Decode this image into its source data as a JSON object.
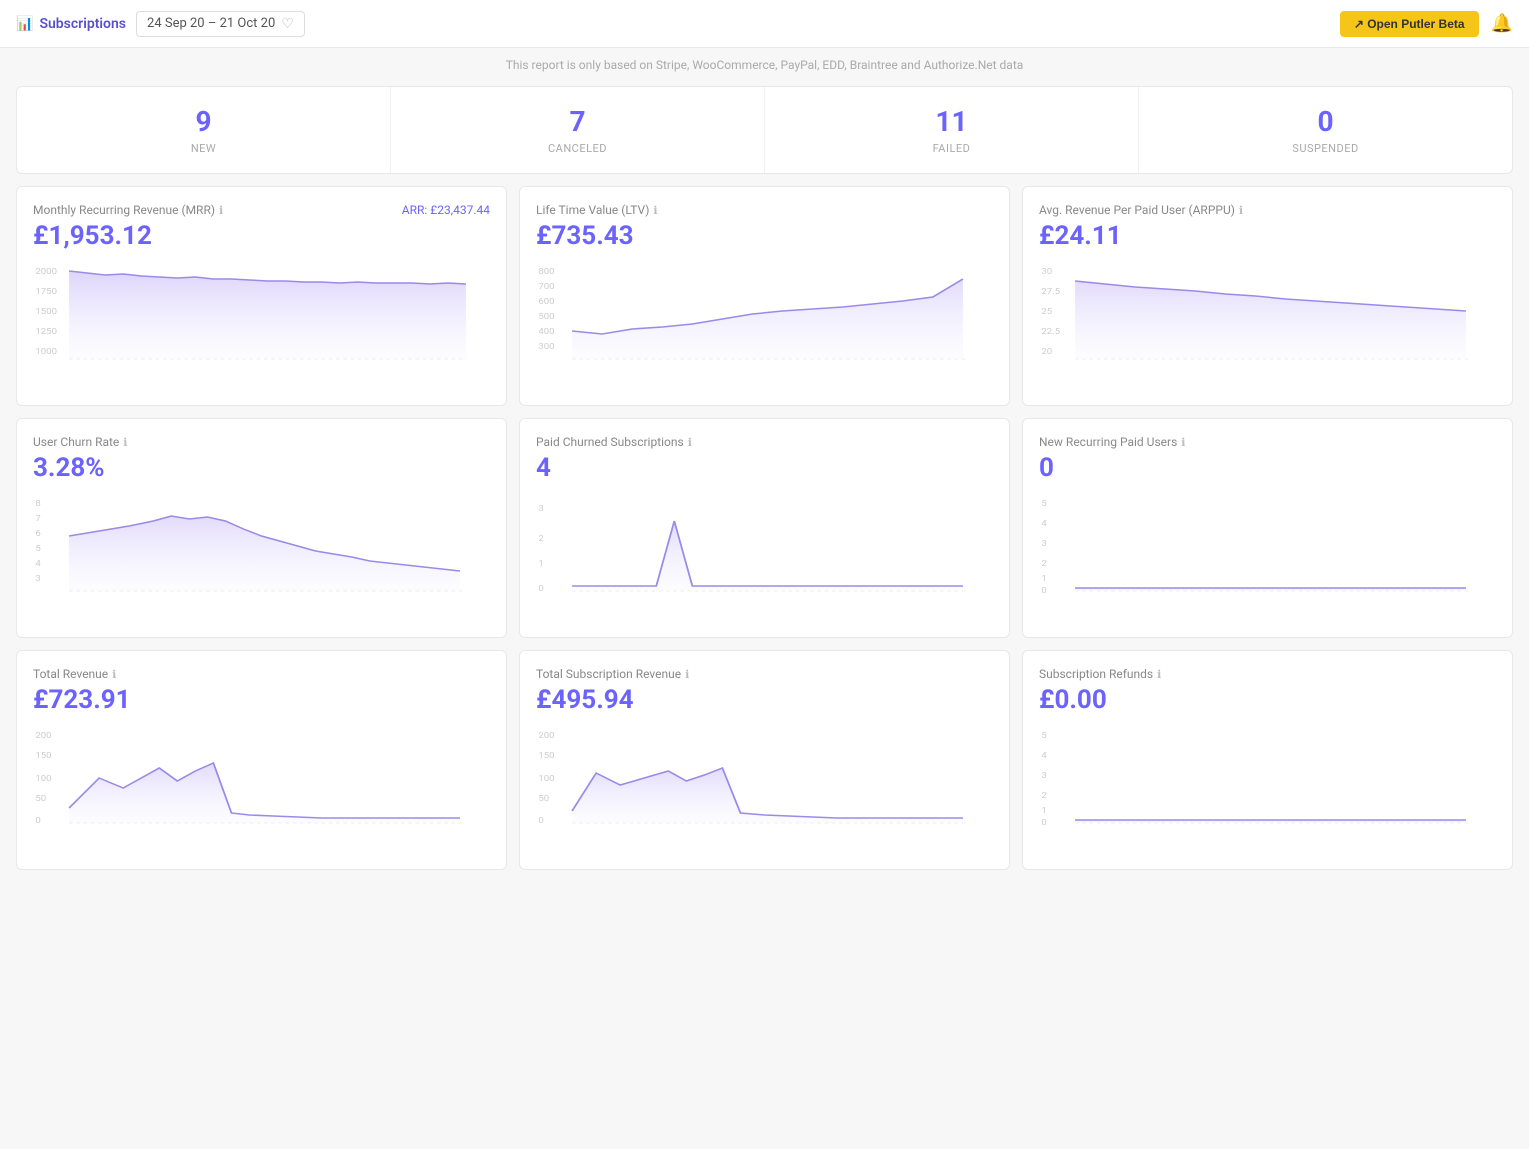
{
  "header": {
    "title": "Subscriptions",
    "title_icon": "📊",
    "date_range": "24 Sep 20  –  21 Oct 20",
    "btn_label": "↗ Open Putler Beta",
    "bell_icon": "🔔"
  },
  "notice": "This report is only based on Stripe, WooCommerce, PayPal, EDD, Braintree and Authorize.Net data",
  "summary": [
    {
      "number": "9",
      "label": "NEW"
    },
    {
      "number": "7",
      "label": "CANCELED"
    },
    {
      "number": "11",
      "label": "FAILED"
    },
    {
      "number": "0",
      "label": "SUSPENDED"
    }
  ],
  "cards": [
    {
      "id": "mrr",
      "title": "Monthly Recurring Revenue (MRR)",
      "info": "ℹ",
      "arr_label": "ARR:",
      "arr_value": "£23,437.44",
      "value": "£1,953.12",
      "chart_type": "area_flat_high"
    },
    {
      "id": "ltv",
      "title": "Life Time Value (LTV)",
      "info": "ℹ",
      "value": "£735.43",
      "chart_type": "area_rising"
    },
    {
      "id": "arppu",
      "title": "Avg. Revenue Per Paid User (ARPPU)",
      "info": "ℹ",
      "value": "£24.11",
      "chart_type": "area_slight_down"
    },
    {
      "id": "churn",
      "title": "User Churn Rate",
      "info": "ℹ",
      "value": "3.28%",
      "chart_type": "area_down_wave"
    },
    {
      "id": "churned_subs",
      "title": "Paid Churned Subscriptions",
      "info": "ℹ",
      "value": "4",
      "chart_type": "area_spike"
    },
    {
      "id": "new_recurring",
      "title": "New Recurring Paid Users",
      "info": "ℹ",
      "value": "0",
      "chart_type": "area_flat_zero"
    },
    {
      "id": "total_revenue",
      "title": "Total Revenue",
      "info": "ℹ",
      "value": "£723.91",
      "chart_type": "area_drop_early"
    },
    {
      "id": "total_sub_revenue",
      "title": "Total Subscription Revenue",
      "info": "ℹ",
      "value": "£495.94",
      "chart_type": "area_drop_early2"
    },
    {
      "id": "refunds",
      "title": "Subscription Refunds",
      "info": "ℹ",
      "value": "£0.00",
      "chart_type": "area_flat_zero2"
    }
  ]
}
